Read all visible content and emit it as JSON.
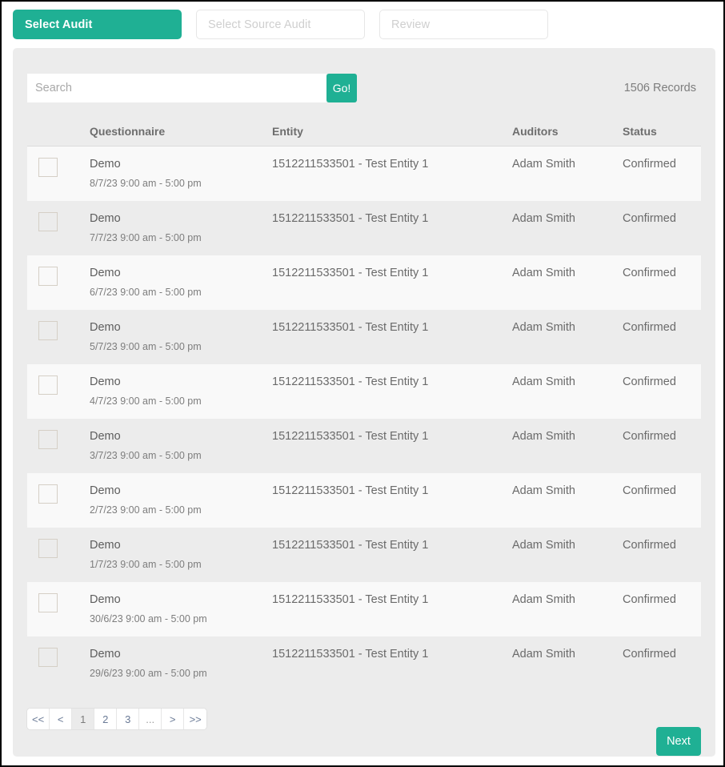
{
  "wizard": {
    "steps": [
      {
        "label": "Select Audit",
        "state": "active"
      },
      {
        "label": "Select Source Audit",
        "state": "inactive"
      },
      {
        "label": "Review",
        "state": "inactive"
      }
    ]
  },
  "search": {
    "value": "",
    "placeholder": "Search",
    "go_label": "Go!"
  },
  "records_label": "1506 Records",
  "table": {
    "headers": {
      "select": "",
      "questionnaire": "Questionnaire",
      "entity": "Entity",
      "auditors": "Auditors",
      "status": "Status"
    },
    "rows": [
      {
        "questionnaire": "Demo",
        "schedule": "8/7/23 9:00 am - 5:00 pm",
        "entity": "1512211533501 - Test Entity 1",
        "auditors": "Adam Smith",
        "status": "Confirmed"
      },
      {
        "questionnaire": "Demo",
        "schedule": "7/7/23 9:00 am - 5:00 pm",
        "entity": "1512211533501 - Test Entity 1",
        "auditors": "Adam Smith",
        "status": "Confirmed"
      },
      {
        "questionnaire": "Demo",
        "schedule": "6/7/23 9:00 am - 5:00 pm",
        "entity": "1512211533501 - Test Entity 1",
        "auditors": "Adam Smith",
        "status": "Confirmed"
      },
      {
        "questionnaire": "Demo",
        "schedule": "5/7/23 9:00 am - 5:00 pm",
        "entity": "1512211533501 - Test Entity 1",
        "auditors": "Adam Smith",
        "status": "Confirmed"
      },
      {
        "questionnaire": "Demo",
        "schedule": "4/7/23 9:00 am - 5:00 pm",
        "entity": "1512211533501 - Test Entity 1",
        "auditors": "Adam Smith",
        "status": "Confirmed"
      },
      {
        "questionnaire": "Demo",
        "schedule": "3/7/23 9:00 am - 5:00 pm",
        "entity": "1512211533501 - Test Entity 1",
        "auditors": "Adam Smith",
        "status": "Confirmed"
      },
      {
        "questionnaire": "Demo",
        "schedule": "2/7/23 9:00 am - 5:00 pm",
        "entity": "1512211533501 - Test Entity 1",
        "auditors": "Adam Smith",
        "status": "Confirmed"
      },
      {
        "questionnaire": "Demo",
        "schedule": "1/7/23 9:00 am - 5:00 pm",
        "entity": "1512211533501 - Test Entity 1",
        "auditors": "Adam Smith",
        "status": "Confirmed"
      },
      {
        "questionnaire": "Demo",
        "schedule": "30/6/23 9:00 am - 5:00 pm",
        "entity": "1512211533501 - Test Entity 1",
        "auditors": "Adam Smith",
        "status": "Confirmed"
      },
      {
        "questionnaire": "Demo",
        "schedule": "29/6/23 9:00 am - 5:00 pm",
        "entity": "1512211533501 - Test Entity 1",
        "auditors": "Adam Smith",
        "status": "Confirmed"
      }
    ]
  },
  "pagination": {
    "items": [
      {
        "label": "<<",
        "name": "first",
        "state": "normal"
      },
      {
        "label": "<",
        "name": "previous",
        "state": "normal"
      },
      {
        "label": "1",
        "name": "page-1",
        "state": "active"
      },
      {
        "label": "2",
        "name": "page-2",
        "state": "normal"
      },
      {
        "label": "3",
        "name": "page-3",
        "state": "normal"
      },
      {
        "label": "...",
        "name": "ellipsis",
        "state": "dots"
      },
      {
        "label": ">",
        "name": "next",
        "state": "normal"
      },
      {
        "label": ">>",
        "name": "last",
        "state": "normal"
      }
    ]
  },
  "footer": {
    "next_label": "Next"
  },
  "colors": {
    "accent": "#1fb094",
    "panel_bg": "#ececec",
    "row_odd": "#f9f9f9",
    "row_even": "#ececec"
  }
}
